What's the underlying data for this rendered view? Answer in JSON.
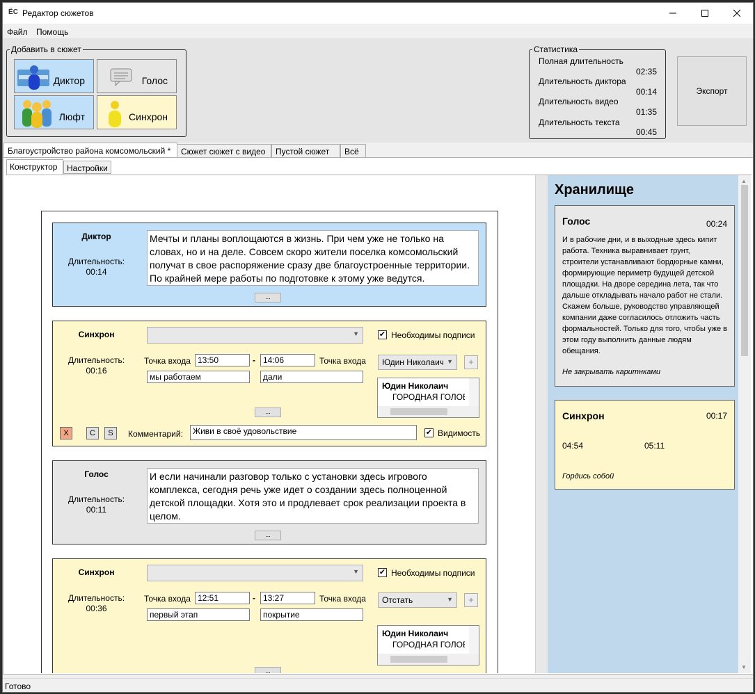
{
  "window": {
    "title": "Редактор сюжетов",
    "app_icon": "ЁС"
  },
  "menu": {
    "file": "Файл",
    "help": "Помощь"
  },
  "add_group": {
    "legend": "Добавить в сюжет",
    "buttons": [
      {
        "label": "Диктор",
        "color": "#bfe0f8"
      },
      {
        "label": "Голос",
        "color": "#e6e6e6"
      },
      {
        "label": "Люфт",
        "color": "#bfe0f8"
      },
      {
        "label": "Синхрон",
        "color": "#fff7cc"
      }
    ]
  },
  "stats": {
    "legend": "Статистика",
    "rows": [
      {
        "label": "Полная длительность",
        "value": "02:35"
      },
      {
        "label": "Длительность диктора",
        "value": "00:14"
      },
      {
        "label": "Длительность видео",
        "value": "01:35"
      },
      {
        "label": "Длительность текста",
        "value": "00:45"
      }
    ]
  },
  "export_label": "Экспорт",
  "tabs": [
    "Благоустройство района комсомольский *",
    "Сюжет сюжет с видео",
    "Пустой сюжет",
    "Всё"
  ],
  "subtabs": [
    "Конструктор",
    "Настройки"
  ],
  "cards": {
    "c1": {
      "kind": "Диктор",
      "dur_label": "Длительность:",
      "dur": "00:14",
      "text": "Мечты и планы воплощаются в жизнь. При чем уже не только на словах, но и на деле. Совсем скоро жители поселка комсомольский получат в свое распоряжение сразу две благоустроенные территории. По крайней мере работы по подготовке к этому уже ведутся.",
      "more": "..."
    },
    "c2": {
      "kind": "Синхрон",
      "dur_label": "Длительность:",
      "dur": "00:16",
      "combo": "",
      "need_subs": "Необходимы подписи",
      "in_label": "Точка входа",
      "in_time": "13:50",
      "dash": "-",
      "out_time": "14:06",
      "out_label": "Точка входа",
      "in_words": "мы работаем",
      "out_words": "дали",
      "person_combo": "Юдин Николаич",
      "list_name": "Юдин Николаич",
      "list_role": "ГОРОДНАЯ ГОЛОВА",
      "more": "...",
      "x_btn": "X",
      "c_btn": "C",
      "s_btn": "S",
      "comment_label": "Комментарий:",
      "comment": "Живи в своё удовольствие",
      "visibility": "Видимость"
    },
    "c3": {
      "kind": "Голос",
      "dur_label": "Длительность:",
      "dur": "00:11",
      "text": "И если начинали разговор только с установки здесь игрового комплекса, сегодня речь уже идет о создании здесь полноценной детской площадки. Хотя это и продлевает срок реализации проекта в целом.",
      "more": "..."
    },
    "c4": {
      "kind": "Синхрон",
      "dur_label": "Длительность:",
      "dur": "00:36",
      "combo": "",
      "need_subs": "Необходимы подписи",
      "in_label": "Точка входа",
      "in_time": "12:51",
      "dash": "-",
      "out_time": "13:27",
      "out_label": "Точка входа",
      "in_words": "первый этап",
      "out_words": "покрытие",
      "person_combo": "Отстать",
      "list_name": "Юдин Николаич",
      "list_role": "ГОРОДНАЯ ГОЛОВА",
      "more": "..."
    }
  },
  "storage": {
    "title": "Хранилище",
    "voice": {
      "title": "Голос",
      "dur": "00:24",
      "text": "И в рабочие дни, и в выходные здесь кипит работа. Техника выравнивает грунт, строители устанавливают бордюрные камни, формирующие периметр будущей детской площадки. На дворе середина лета, так что дальше откладывать начало работ не стали. Скажем больше, руководство управляющей компании даже согласилось отложить часть формальностей. Только для того, чтобы уже в этом году выполнить данные людям обещания.",
      "note": "Не закрывать каритнками"
    },
    "sync": {
      "title": "Синхрон",
      "dur": "00:17",
      "in": "04:54",
      "out": "05:11",
      "note": "Гордись собой"
    }
  },
  "status": "Готово"
}
